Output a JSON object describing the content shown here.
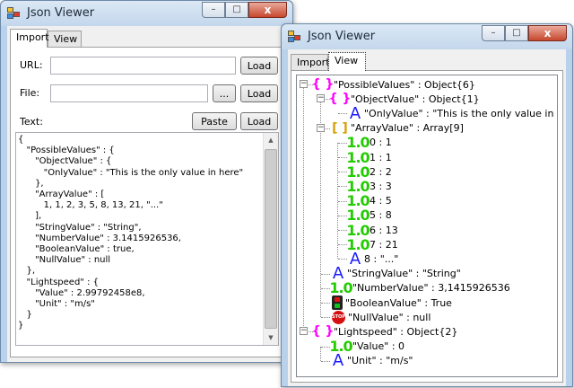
{
  "left_window": {
    "title": "Json Viewer",
    "tabs": [
      {
        "label": "Import"
      },
      {
        "label": "View"
      }
    ],
    "url_label": "URL:",
    "file_label": "File:",
    "text_label": "Text:",
    "load_label": "Load",
    "browse_label": "...",
    "paste_label": "Paste",
    "json_text": "{\n   \"PossibleValues\" : {\n      \"ObjectValue\" : {\n         \"OnlyValue\" : \"This is the only value in here\"\n      },\n      \"ArrayValue\" : [\n         1, 1, 2, 3, 5, 8, 13, 21, \"...\"\n      ],\n      \"StringValue\" : \"String\",\n      \"NumberValue\" : 3.1415926536,\n      \"BooleanValue\" : true,\n      \"NullValue\" : null\n   },\n   \"Lightspeed\" : {\n      \"Value\" : 2.99792458e8,\n      \"Unit\" : \"m/s\"\n   }\n}"
  },
  "right_window": {
    "title": "Json Viewer",
    "tabs": [
      {
        "label": "Import"
      },
      {
        "label": "View"
      }
    ],
    "tree": [
      {
        "text": "\"PossibleValues\" : Object{6}",
        "icon": "object-icon"
      },
      {
        "text": "\"ObjectValue\" : Object{1}",
        "icon": "object-icon"
      },
      {
        "text": "\"OnlyValue\" : \"This is the only value in here\"",
        "icon": "string-icon"
      },
      {
        "text": "\"ArrayValue\" : Array[9]",
        "icon": "array-icon"
      },
      {
        "text": "0 : 1",
        "icon": "number-icon"
      },
      {
        "text": "1 : 1",
        "icon": "number-icon"
      },
      {
        "text": "2 : 2",
        "icon": "number-icon"
      },
      {
        "text": "3 : 3",
        "icon": "number-icon"
      },
      {
        "text": "4 : 5",
        "icon": "number-icon"
      },
      {
        "text": "5 : 8",
        "icon": "number-icon"
      },
      {
        "text": "6 : 13",
        "icon": "number-icon"
      },
      {
        "text": "7 : 21",
        "icon": "number-icon"
      },
      {
        "text": "8 : \"...\"",
        "icon": "string-icon"
      },
      {
        "text": "\"StringValue\" : \"String\"",
        "icon": "string-icon"
      },
      {
        "text": "\"NumberValue\" : 3,1415926536",
        "icon": "number-icon"
      },
      {
        "text": "\"BooleanValue\" : True",
        "icon": "boolean-icon"
      },
      {
        "text": "\"NullValue\" : null",
        "icon": "null-icon"
      },
      {
        "text": "\"Lightspeed\" : Object{2}",
        "icon": "object-icon"
      },
      {
        "text": "\"Value\" : 0",
        "icon": "number-icon"
      },
      {
        "text": "\"Unit\" : \"m/s\"",
        "icon": "string-icon"
      }
    ],
    "icon_glyphs": {
      "object": "{ }",
      "array": "[ ]",
      "string": "A",
      "number": "1.0",
      "null": "STOP"
    }
  },
  "window_controls": {
    "minimize": "–",
    "maximize": "□",
    "close": "x"
  }
}
